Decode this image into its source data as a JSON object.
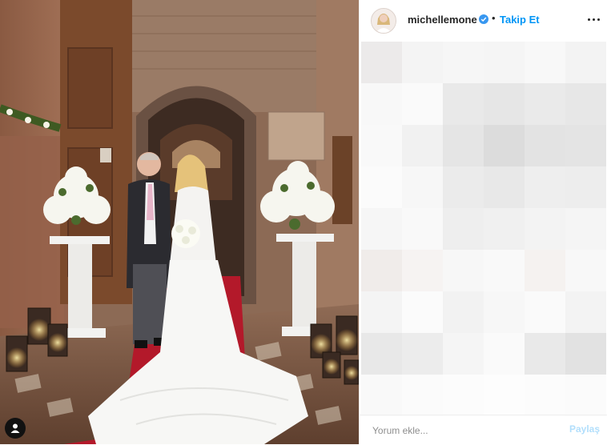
{
  "post": {
    "username": "michellemone",
    "follow_label": "Takip Et",
    "separator": "•",
    "verified_icon": "verified-badge-icon",
    "more_icon": "more-options-icon"
  },
  "photo": {
    "description_icon": "user-tag-icon"
  },
  "comment": {
    "placeholder": "Yorum ekle...",
    "share_label": "Paylaş"
  },
  "colors": {
    "accent": "#0095f6",
    "share_disabled": "#b2dffc",
    "verified": "#3897f0"
  }
}
